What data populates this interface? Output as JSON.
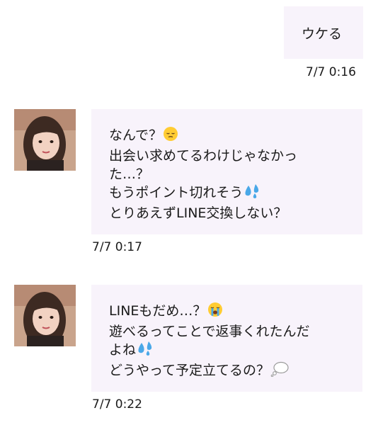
{
  "messages": [
    {
      "sender": "self",
      "lines": [
        "ウケる"
      ],
      "time": "7/7 0:16"
    },
    {
      "sender": "other",
      "lines": [
        {
          "text": "なんで？",
          "emoji": "pensive-face-emoji"
        },
        {
          "text": "出会い求めてるわけじゃなかっ",
          "emoji": ""
        },
        {
          "text": "た…？",
          "emoji": ""
        },
        {
          "text": "もうポイント切れそう",
          "emoji": "sweat-droplets-emoji"
        },
        {
          "text": "とりあえずLINE交換しない？",
          "emoji": ""
        }
      ],
      "time": "7/7 0:17"
    },
    {
      "sender": "other",
      "lines": [
        {
          "text": "LINEもだめ…？",
          "emoji": "loudly-crying-face-emoji"
        },
        {
          "text": "遊べるってことで返事くれたんだ",
          "emoji": ""
        },
        {
          "text": "よね",
          "emoji": "sweat-droplets-emoji"
        },
        {
          "text": "どうやって予定立てるの？",
          "emoji": "thought-balloon-emoji"
        }
      ],
      "time": "7/7 0:22"
    }
  ],
  "colors": {
    "bubble": "#f8f3fb",
    "text": "#1a1a1a",
    "background": "#ffffff"
  }
}
